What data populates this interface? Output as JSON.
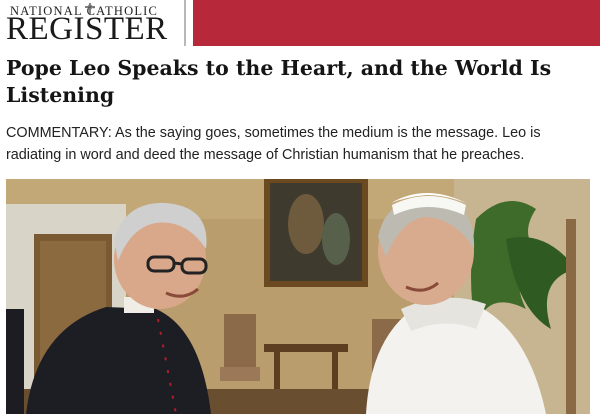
{
  "masthead": {
    "logo_top": "NATIONAL CATHOLIC",
    "logo_main": "REGISTER",
    "emblem_icon": "cross-emblem-icon",
    "band_color": "#b6283a"
  },
  "article": {
    "title": "Pope Leo Speaks to the Heart, and the World Is Listening",
    "summary": "COMMENTARY: As the saying goes, sometimes the medium is the message. Leo is radiating in word and deed the message of Christian humanism that he preaches."
  }
}
